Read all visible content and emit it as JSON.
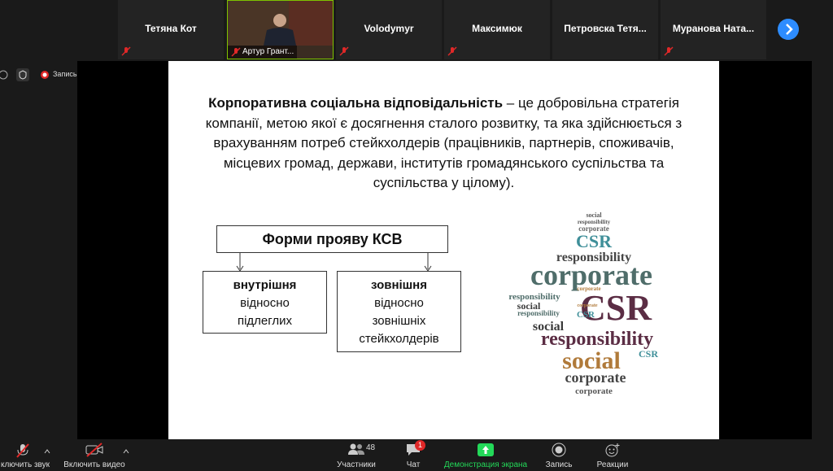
{
  "participants_strip": [
    {
      "name": "Тетяна Кот"
    },
    {
      "name": "Артур Грант..."
    },
    {
      "name": "Volodymyr"
    },
    {
      "name": "Максимюк"
    },
    {
      "name": "Петровска Тетя..."
    },
    {
      "name": "Муранова Ната..."
    }
  ],
  "top_bar": {
    "record_label": "Запись"
  },
  "slide": {
    "def_bold": "Корпоративна соціальна відповідальність",
    "def_rest": " – це добровільна стратегія компанії, метою якої є досягнення сталого розвитку, та яка здійснюється з врахуванням потреб стейкхолдерів (працівників, партнерів, споживачів, місцевих громад, держави, інститутів громадянського суспільства та суспільства у цілому).",
    "forms_title": "Форми прояву КСВ",
    "left_box": {
      "bold": "внутрішня",
      "line2": "відносно",
      "line3": "підлеглих"
    },
    "right_box": {
      "bold": "зовнішня",
      "line2": "відносно",
      "line3": "зовнішніх",
      "line4": "стейкхолдерів"
    }
  },
  "word_cloud": {
    "words": [
      "social",
      "responsibility",
      "corporate",
      "CSR",
      "responsibility",
      "corporate",
      "responsibility",
      "CSR",
      "social",
      "corporate",
      "responsibility",
      "corporate",
      "CSR",
      "social",
      "responsibility",
      "CSR",
      "social",
      "corporate",
      "corporate"
    ]
  },
  "toolbar": {
    "unmute": "ключить звук",
    "start_video": "Включить видео",
    "participants": "Участники",
    "participants_count": "48",
    "chat": "Чат",
    "chat_badge": "1",
    "share": "Демонстрация экрана",
    "record": "Запись",
    "reactions": "Реакции"
  },
  "colors": {
    "share_green": "#23d959",
    "accent_blue": "#2d8cff",
    "muted_red": "#e02828"
  }
}
